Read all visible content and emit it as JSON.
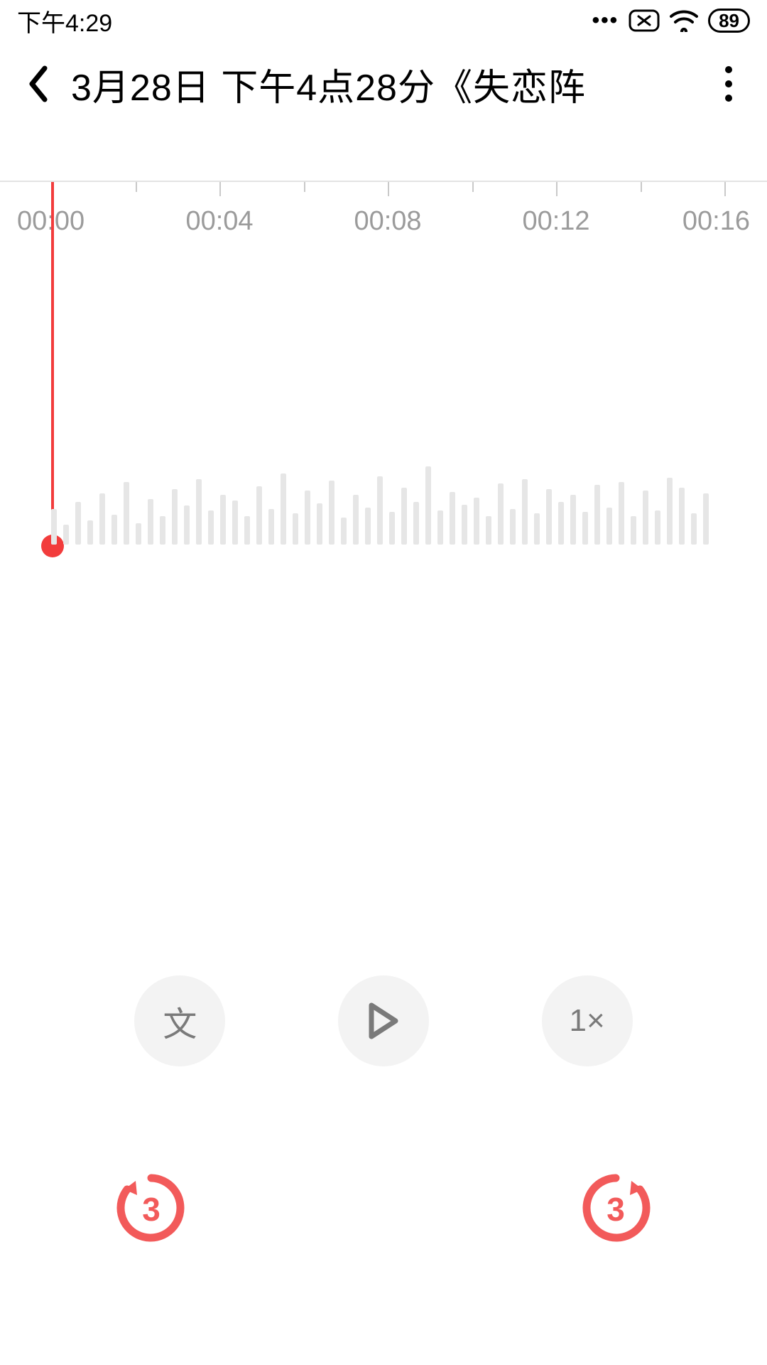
{
  "status": {
    "time": "下午4:29",
    "battery": "89"
  },
  "header": {
    "title": "3月28日 下午4点28分《失恋阵"
  },
  "timeline": {
    "ticks": [
      "00:00",
      "00:04",
      "00:08",
      "00:12",
      "00:16"
    ],
    "playhead_at": "00:00",
    "waveform": [
      50,
      28,
      60,
      34,
      72,
      42,
      88,
      30,
      64,
      40,
      78,
      55,
      92,
      48,
      70,
      62,
      40,
      82,
      50,
      100,
      44,
      76,
      58,
      90,
      38,
      70,
      52,
      96,
      46,
      80,
      60,
      110,
      48,
      74,
      56,
      66,
      40,
      86,
      50,
      92,
      44,
      78,
      60,
      70,
      46,
      84,
      52,
      88,
      40,
      76,
      48,
      94,
      80,
      44,
      72
    ]
  },
  "controls": {
    "transcribe_label": "文",
    "speed_label": "1×",
    "skip_seconds": "3"
  },
  "colors": {
    "accent": "#f23c3c",
    "muted": "#9b9b9b"
  }
}
